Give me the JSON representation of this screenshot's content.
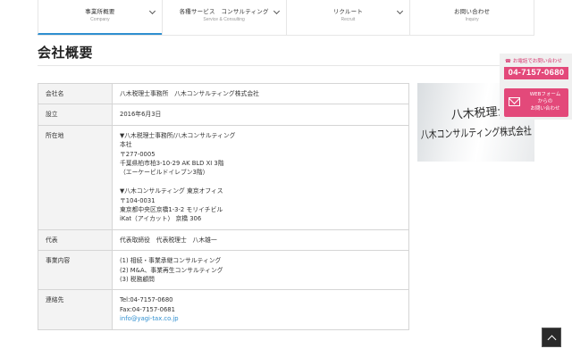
{
  "nav": [
    {
      "ja": "事業所概要",
      "en": "Company"
    },
    {
      "ja": "各種サービス　コンサルティング",
      "en": "Service & Consulting"
    },
    {
      "ja": "リクルート",
      "en": "Recruit"
    },
    {
      "ja": "お問い合わせ",
      "en": "Inquiry"
    }
  ],
  "page": {
    "title": "会社概要"
  },
  "table": {
    "company_name": {
      "label": "会社名",
      "value": "八木税理士事務所　八木コンサルティング株式会社"
    },
    "established": {
      "label": "設立",
      "value": "2016年6月3日"
    },
    "address": {
      "label": "所在地",
      "lines1": [
        "▼八木税理士事務所/八木コンサルティング",
        "本社",
        "〒277-0005",
        "千葉県柏市柏3-10-29 AK BLD XI 3階",
        "（エーケービルドイレブン3階）"
      ],
      "lines2": [
        "▼八木コンサルティング 東京オフィス",
        "〒104-0031",
        "東京都中央区京橋1-3-2 モリイチビル",
        "iKat（アイカット） 京橋 306"
      ]
    },
    "representative": {
      "label": "代表",
      "value": "代表取締役　代表税理士　八木雄一"
    },
    "business": {
      "label": "事業内容",
      "lines": [
        "(1) 相続・事業承継コンサルティング",
        "(2) M&A、事業再生コンサルティング",
        "(3) 税務顧問"
      ]
    },
    "contact": {
      "label": "連絡先",
      "tel": "Tel:04-7157-0680",
      "fax": "Fax:04-7157-0681",
      "email": "info@yagi-tax.co.jp"
    }
  },
  "sign": {
    "line1": "八木税理士事務",
    "line2": "八木コンサルティング株式会社"
  },
  "side": {
    "tel_label": "お電話でお問い合わせ",
    "tel_number": "04-7157-0680",
    "web_lines": [
      "WEBフォーム",
      "からの",
      "お問い合わせ"
    ]
  },
  "colors": {
    "accent_pink": "#e3497a",
    "link_blue": "#2f8fd0"
  }
}
